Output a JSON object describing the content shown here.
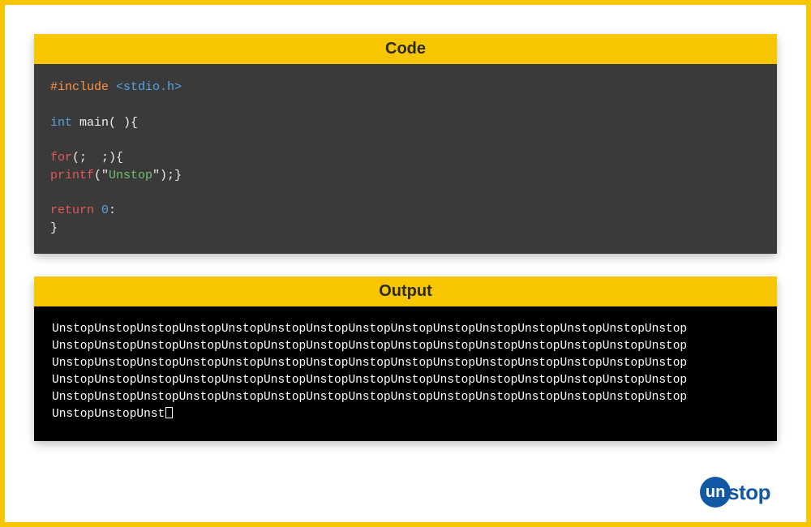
{
  "frame": {
    "border_color": "#f7c600"
  },
  "code_panel": {
    "header": "Code",
    "lines": [
      [
        {
          "cls": "tok-orange",
          "text": "#include "
        },
        {
          "cls": "tok-blue",
          "text": "<stdio.h>"
        }
      ],
      [],
      [
        {
          "cls": "tok-blue",
          "text": "int "
        },
        {
          "cls": "tok-white",
          "text": "main( ){"
        }
      ],
      [],
      [
        {
          "cls": "tok-red",
          "text": "for"
        },
        {
          "cls": "tok-white",
          "text": "(;  ;){"
        }
      ],
      [
        {
          "cls": "tok-red",
          "text": "printf"
        },
        {
          "cls": "tok-white",
          "text": "(\""
        },
        {
          "cls": "tok-green",
          "text": "Unstop"
        },
        {
          "cls": "tok-white",
          "text": "\");}"
        }
      ],
      [],
      [
        {
          "cls": "tok-red",
          "text": "return "
        },
        {
          "cls": "tok-blue",
          "text": "0"
        },
        {
          "cls": "tok-white",
          "text": ":"
        }
      ],
      [
        {
          "cls": "tok-white",
          "text": "}"
        }
      ]
    ]
  },
  "output_panel": {
    "header": "Output",
    "lines": [
      "UnstopUnstopUnstopUnstopUnstopUnstopUnstopUnstopUnstopUnstopUnstopUnstopUnstopUnstopUnstop",
      "UnstopUnstopUnstopUnstopUnstopUnstopUnstopUnstopUnstopUnstopUnstopUnstopUnstopUnstopUnstop",
      "UnstopUnstopUnstopUnstopUnstopUnstopUnstopUnstopUnstopUnstopUnstopUnstopUnstopUnstopUnstop",
      "UnstopUnstopUnstopUnstopUnstopUnstopUnstopUnstopUnstopUnstopUnstopUnstopUnstopUnstopUnstop",
      "UnstopUnstopUnstopUnstopUnstopUnstopUnstopUnstopUnstopUnstopUnstopUnstopUnstopUnstopUnstop",
      "UnstopUnstopUnst"
    ],
    "trailing_cursor": true
  },
  "logo": {
    "circle_text": "un",
    "rest_text": "stop",
    "brand_color": "#1259a5"
  }
}
